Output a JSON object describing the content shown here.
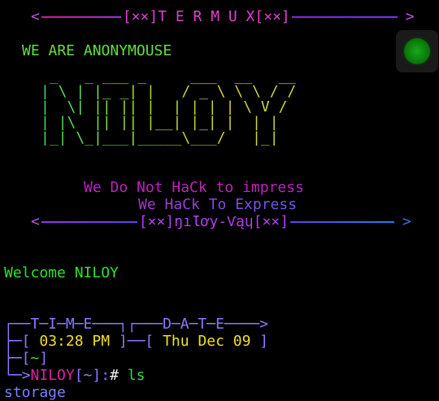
{
  "banner_top": {
    "left_arrow": "<",
    "title": "[××]T E R M U X[××]",
    "right_arrow": ">"
  },
  "intro": "WE ARE ANONYMOUSE",
  "ascii_art": [
    " _   _ ___ _     ___  __   __",
    "| \\ | |_ _| |   / _ \\ \\ \\ / /",
    "|  \\| || || |  | | | | \\ V / ",
    "| |\\  || || |__| |_| |  | |  ",
    "|_| \\_|___|_____\\___/   |_|  "
  ],
  "tagline_1": "We Do Not HaCk to impress",
  "tagline_2": "We HaCk To Express",
  "banner_bottom": {
    "left_arrow": "<",
    "title": "[××]ŋıƖơy-Ѵąɥ[××]",
    "right_arrow": ">"
  },
  "welcome": "Welcome NILOY",
  "prompt": {
    "time_header": "┌──T─I─M─E───┐┌───D─A─T─E────>",
    "time_open": "├─[ ",
    "time_value": "03:28 PM",
    "time_mid": " ]──[ ",
    "date_value": "Thu Dec 09",
    "date_close": " ]",
    "dir_open": "├─[",
    "dir_value": "~",
    "dir_close": "]",
    "cmd_prefix": "└─>",
    "user": "NILOY",
    "cwd": "[~]:",
    "hash": "#",
    "command": " ls"
  },
  "output_line": "storage"
}
